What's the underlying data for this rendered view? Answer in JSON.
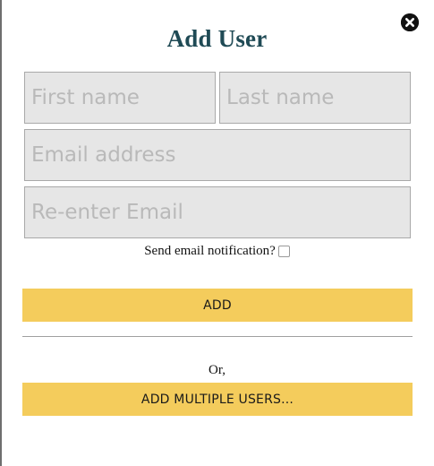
{
  "dialog": {
    "title": "Add User",
    "close_icon": "close-circle-icon"
  },
  "form": {
    "first_name": {
      "placeholder": "First name",
      "value": ""
    },
    "last_name": {
      "placeholder": "Last name",
      "value": ""
    },
    "email": {
      "placeholder": "Email address",
      "value": ""
    },
    "email_confirm": {
      "placeholder": "Re-enter Email",
      "value": ""
    },
    "notify_label": "Send email notification?",
    "notify_checked": false
  },
  "actions": {
    "add_label": "ADD",
    "or_label": "Or,",
    "add_multiple_label": "ADD MULTIPLE USERS..."
  },
  "colors": {
    "title": "#1f4a55",
    "button_bg": "#f4cc5c",
    "field_bg": "#e6e6e6"
  }
}
